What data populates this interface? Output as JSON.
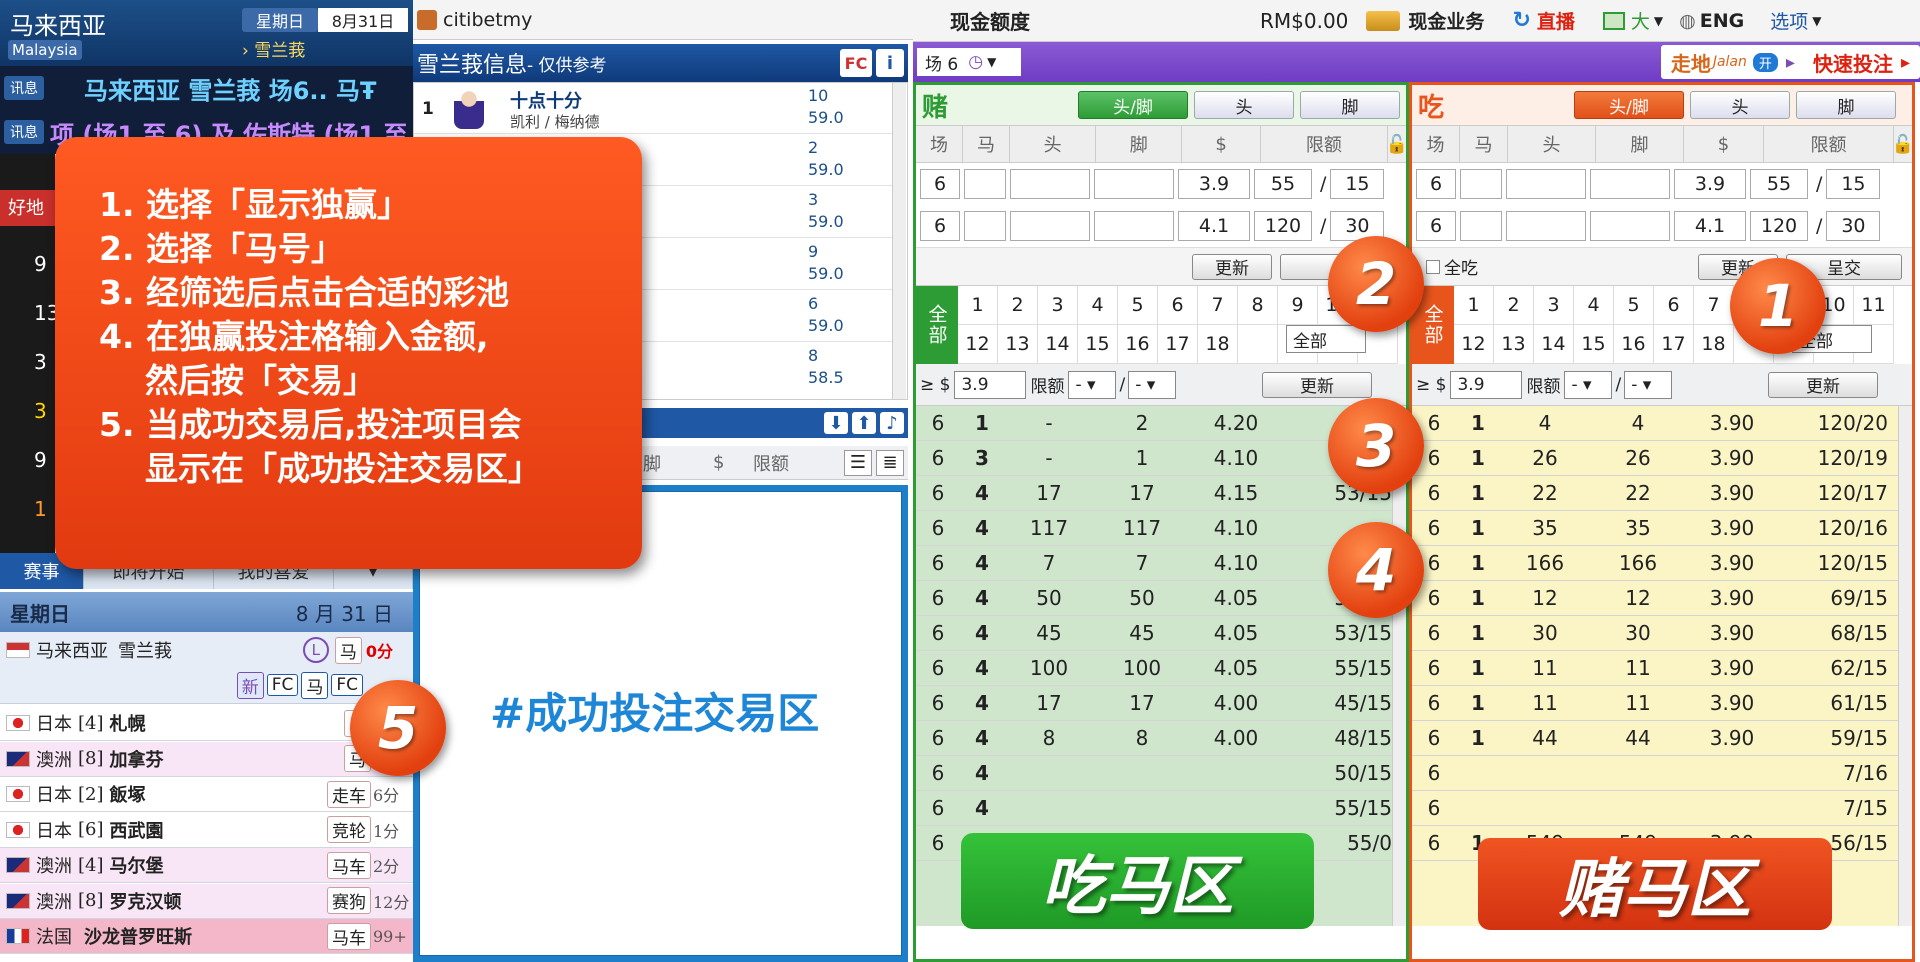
{
  "left": {
    "country_cn": "马来西亚",
    "country_en": "Malaysia",
    "weekday": "星期日",
    "date": "8月31日",
    "venue": "雪兰莪",
    "ticker_label": "讯息",
    "ticker1": "马来西亚 雪兰莪 场6.. 马Ŧ",
    "ticker2": "项 (场1 至 6) 及 佐斯特 (场1 至",
    "tab_races": "赛事",
    "tab_soon": "即将开始",
    "tab_fav": "我的喜爱",
    "day_label": "星期日",
    "day_date": "8 月 31 日",
    "featured": {
      "country": "马来西亚",
      "venue": "雪兰莪",
      "tag": "马",
      "mins": "0分"
    },
    "featured_badges": [
      "新",
      "FC",
      "马",
      "FC"
    ],
    "races": [
      {
        "country": "日本",
        "num": "[4]",
        "venue": "札幌",
        "tag": "马",
        "mins": ""
      },
      {
        "country": "澳洲",
        "num": "[8]",
        "venue": "加拿芬",
        "tag": "马",
        "mins": ""
      },
      {
        "country": "日本",
        "num": "[2]",
        "venue": "飯塚",
        "tag": "走车",
        "mins": "6分"
      },
      {
        "country": "日本",
        "num": "[6]",
        "venue": "西武園",
        "tag": "竞轮",
        "mins": "1分"
      },
      {
        "country": "澳洲",
        "num": "[4]",
        "venue": "马尔堡",
        "tag": "马车",
        "mins": "2分"
      },
      {
        "country": "澳洲",
        "num": "[8]",
        "venue": "罗克汉顿",
        "tag": "赛狗",
        "mins": "12分"
      },
      {
        "country": "法国",
        "num": "",
        "venue": "沙龙普罗旺斯",
        "tag": "马车",
        "mins": "99+"
      }
    ],
    "partial_labels": [
      "好地",
      "9",
      "13",
      "3",
      "3",
      "9",
      "1"
    ]
  },
  "center": {
    "account": "citibetmy",
    "info_title": "雪兰莪信息",
    "info_sub": "- 仅供参考",
    "fc": "FC",
    "info_icon": "i",
    "runner1_num": "1",
    "runner1_name": "十点十分",
    "runner1_jockey": "凯利 / 梅纳德",
    "runners": [
      {
        "no": "10",
        "wt": "59.0"
      },
      {
        "no": "2",
        "wt": "59.0"
      },
      {
        "no": "3",
        "wt": "59.0"
      },
      {
        "no": "9",
        "wt": "59.0"
      },
      {
        "no": "6",
        "wt": "59.0"
      },
      {
        "no": "8",
        "wt": "58.5"
      }
    ],
    "hdr_foot": "脚",
    "hdr_dollar": "$",
    "hdr_limit": "限额",
    "confirm_label": "#成功投注交易区"
  },
  "topbar": {
    "cash_label": "现金额度",
    "cash_value": "RM$0.00",
    "cash_business": "现金业务",
    "live": "直播",
    "size": "大",
    "lang": "ENG",
    "options": "选项",
    "race_select": "场 6",
    "walk_label": "走地",
    "walk_brand": "Jalan",
    "walk_toggle": "开",
    "quick_bet": "快速投注"
  },
  "bet_left": {
    "title": "赌",
    "btn_both": "头/脚",
    "btn_head": "头",
    "btn_foot": "脚",
    "cols": [
      "场",
      "马",
      "头",
      "脚",
      "$",
      "限额"
    ],
    "rows": [
      {
        "race": "6",
        "price": "3.9",
        "lim1": "55",
        "lim2": "15"
      },
      {
        "race": "6",
        "price": "4.1",
        "lim1": "120",
        "lim2": "30"
      }
    ],
    "update": "更新",
    "all": "全部",
    "nums_row1": [
      "1",
      "2",
      "3",
      "4",
      "5",
      "6",
      "7",
      "8",
      "9",
      "10"
    ],
    "nums_row2": [
      "12",
      "13",
      "14",
      "15",
      "16",
      "17",
      "18"
    ],
    "all_select": "全部",
    "filter_ge": "≥ $",
    "filter_val": "3.9",
    "filter_limit": "限额",
    "filter_update": "更新",
    "data": [
      [
        "6",
        "1",
        "-",
        "2",
        "4.20",
        ""
      ],
      [
        "6",
        "3",
        "-",
        "1",
        "4.10",
        "6/"
      ],
      [
        "6",
        "4",
        "17",
        "17",
        "4.15",
        "53/15"
      ],
      [
        "6",
        "4",
        "117",
        "117",
        "4.10",
        ""
      ],
      [
        "6",
        "4",
        "7",
        "7",
        "4.10",
        "55/1"
      ],
      [
        "6",
        "4",
        "50",
        "50",
        "4.05",
        "52/15"
      ],
      [
        "6",
        "4",
        "45",
        "45",
        "4.05",
        "53/15"
      ],
      [
        "6",
        "4",
        "100",
        "100",
        "4.05",
        "55/15"
      ],
      [
        "6",
        "4",
        "17",
        "17",
        "4.00",
        "45/15"
      ],
      [
        "6",
        "4",
        "8",
        "8",
        "4.00",
        "48/15"
      ],
      [
        "6",
        "4",
        "",
        "",
        "",
        "50/15"
      ],
      [
        "6",
        "4",
        "",
        "",
        "",
        "55/15"
      ],
      [
        "6",
        "4",
        "11",
        "-",
        "4.00",
        "55/0"
      ]
    ]
  },
  "bet_right": {
    "title": "吃",
    "btn_both": "头/脚",
    "btn_head": "头",
    "btn_foot": "脚",
    "cols": [
      "场",
      "马",
      "头",
      "脚",
      "$",
      "限额"
    ],
    "rows": [
      {
        "race": "6",
        "price": "3.9",
        "lim1": "55",
        "lim2": "15"
      },
      {
        "race": "6",
        "price": "4.1",
        "lim1": "120",
        "lim2": "30"
      }
    ],
    "all_eat": "全吃",
    "update": "更新",
    "submit": "呈交",
    "all": "全部",
    "nums_row1": [
      "1",
      "2",
      "3",
      "4",
      "5",
      "6",
      "7",
      "",
      "",
      "10",
      "11"
    ],
    "nums_row2": [
      "12",
      "13",
      "14",
      "15",
      "16",
      "17",
      "18"
    ],
    "all_select": "全部",
    "filter_ge": "≥ $",
    "filter_val": "3.9",
    "filter_limit": "限额",
    "filter_update": "更新",
    "data": [
      [
        "6",
        "1",
        "4",
        "4",
        "3.90",
        "120/20"
      ],
      [
        "6",
        "1",
        "26",
        "26",
        "3.90",
        "120/19"
      ],
      [
        "6",
        "1",
        "22",
        "22",
        "3.90",
        "120/17"
      ],
      [
        "6",
        "1",
        "35",
        "35",
        "3.90",
        "120/16"
      ],
      [
        "6",
        "1",
        "166",
        "166",
        "3.90",
        "120/15"
      ],
      [
        "6",
        "1",
        "12",
        "12",
        "3.90",
        "69/15"
      ],
      [
        "6",
        "1",
        "30",
        "30",
        "3.90",
        "68/15"
      ],
      [
        "6",
        "1",
        "11",
        "11",
        "3.90",
        "62/15"
      ],
      [
        "6",
        "1",
        "11",
        "11",
        "3.90",
        "61/15"
      ],
      [
        "6",
        "1",
        "44",
        "44",
        "3.90",
        "59/15"
      ],
      [
        "6",
        "",
        "",
        "",
        "",
        "7/16"
      ],
      [
        "6",
        "",
        "",
        "",
        "",
        "7/15"
      ],
      [
        "6",
        "1",
        "549",
        "549",
        "3.90",
        "56/15"
      ]
    ]
  },
  "overlay": {
    "steps": [
      "1. 选择「显示独赢」",
      "2. 选择「马号」",
      "3. 经筛选后点击合适的彩池",
      "4. 在独赢投注格输入金额,\n    然后按「交易」",
      "5. 当成功交易后,投注项目会\n    显示在「成功投注交易区」"
    ],
    "markers": [
      "1",
      "2",
      "3",
      "4",
      "5"
    ],
    "green_label": "吃马区",
    "red_label": "赌马区"
  }
}
